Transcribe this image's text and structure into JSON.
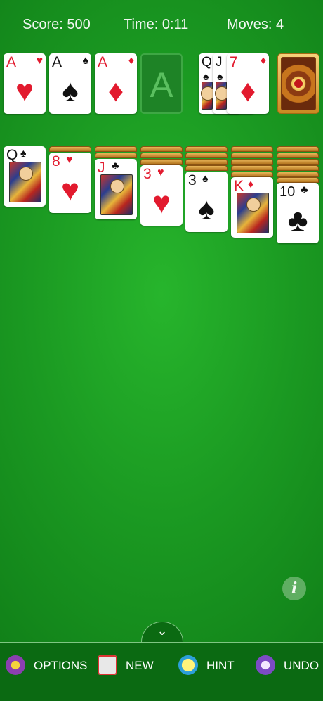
{
  "hud": {
    "score": "Score: 500",
    "time": "Time: 0:11",
    "moves": "Moves: 4"
  },
  "foundations": [
    {
      "rank": "A",
      "suit": "♥",
      "color": "red"
    },
    {
      "rank": "A",
      "suit": "♠",
      "color": "black"
    },
    {
      "rank": "A",
      "suit": "♦",
      "color": "red"
    },
    {
      "placeholder": "A"
    }
  ],
  "waste": [
    {
      "rank": "Q",
      "suit": "♠"
    },
    {
      "rank": "J",
      "suit": "♠"
    },
    {
      "rank": "7",
      "suit": "♦"
    }
  ],
  "tableau": [
    {
      "rank": "Q",
      "suit": "♠"
    },
    {
      "rank": "8",
      "suit": "♥"
    },
    {
      "rank": "J",
      "suit": "♣"
    },
    {
      "rank": "3",
      "suit": "♥"
    },
    {
      "rank": "3",
      "suit": "♠"
    },
    {
      "rank": "K",
      "suit": "♦"
    },
    {
      "rank": "10",
      "suit": "♣"
    }
  ],
  "info_label": "i",
  "toolbar": {
    "toggle_icon": "⌄",
    "options": "OPTIONS",
    "new": "NEW",
    "hint": "HINT",
    "undo": "UNDO"
  },
  "colors": {
    "felt": "#1b9a22",
    "red_suit": "#e21a2e",
    "toolbar": "#0b6a12"
  }
}
